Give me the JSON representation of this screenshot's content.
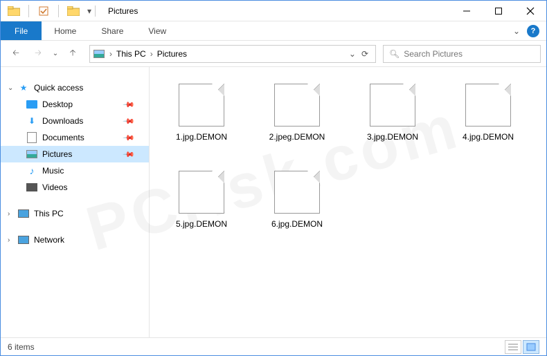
{
  "window": {
    "title": "Pictures"
  },
  "ribbon": {
    "file": "File",
    "tabs": [
      "Home",
      "Share",
      "View"
    ]
  },
  "breadcrumb": {
    "items": [
      "This PC",
      "Pictures"
    ]
  },
  "search": {
    "placeholder": "Search Pictures"
  },
  "sidebar": {
    "quick_access": "Quick access",
    "items": [
      {
        "label": "Desktop",
        "pinned": true
      },
      {
        "label": "Downloads",
        "pinned": true
      },
      {
        "label": "Documents",
        "pinned": true
      },
      {
        "label": "Pictures",
        "pinned": true,
        "selected": true
      },
      {
        "label": "Music",
        "pinned": false
      },
      {
        "label": "Videos",
        "pinned": false
      }
    ],
    "this_pc": "This PC",
    "network": "Network"
  },
  "files": [
    {
      "name": "1.jpg.DEMON"
    },
    {
      "name": "2.jpeg.DEMON"
    },
    {
      "name": "3.jpg.DEMON"
    },
    {
      "name": "4.jpg.DEMON"
    },
    {
      "name": "5.jpg.DEMON"
    },
    {
      "name": "6.jpg.DEMON"
    }
  ],
  "status": {
    "text": "6 items"
  },
  "watermark": "PCrisk.com"
}
